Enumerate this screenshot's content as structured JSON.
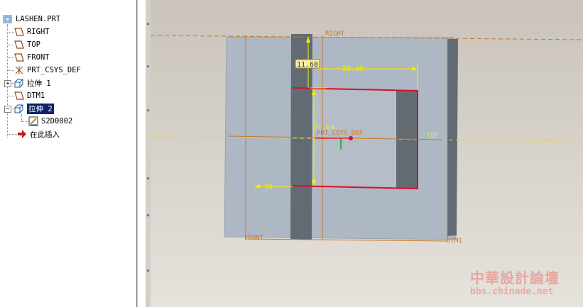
{
  "model_tree": {
    "items": [
      {
        "label": "LASHEN.PRT",
        "icon": "part-icon"
      },
      {
        "label": "RIGHT",
        "icon": "datum-plane-icon"
      },
      {
        "label": "TOP",
        "icon": "datum-plane-icon"
      },
      {
        "label": "FRONT",
        "icon": "datum-plane-icon"
      },
      {
        "label": "PRT_CSYS_DEF",
        "icon": "csys-icon"
      },
      {
        "label": "拉伸 1",
        "icon": "extrude-icon"
      },
      {
        "label": "DTM1",
        "icon": "datum-plane-icon"
      },
      {
        "label": "拉伸 2",
        "icon": "extrude-icon",
        "selected": true
      },
      {
        "label": "S2D0002",
        "icon": "sketch-icon"
      },
      {
        "label": "在此插入",
        "icon": "insert-here-arrow-icon"
      }
    ]
  },
  "viewport": {
    "datum_labels": {
      "right": "RIGHT",
      "top": "TOP",
      "front": "FRONT",
      "dtm1": "DTM1",
      "csys": "PRT_CSYS_DEF"
    },
    "dimensions": {
      "d1": "11.68",
      "d2": "23.49",
      "d3": "21.64",
      "d4": "30"
    },
    "colors": {
      "part": "#aeb8c4",
      "part_dark": "#626a72",
      "datum": "#c8782a",
      "sketch": "#d8102a",
      "dimension": "#f0f000"
    }
  },
  "watermark": {
    "cn": "中華設計論壇",
    "url": "bbs.chinade.net"
  }
}
